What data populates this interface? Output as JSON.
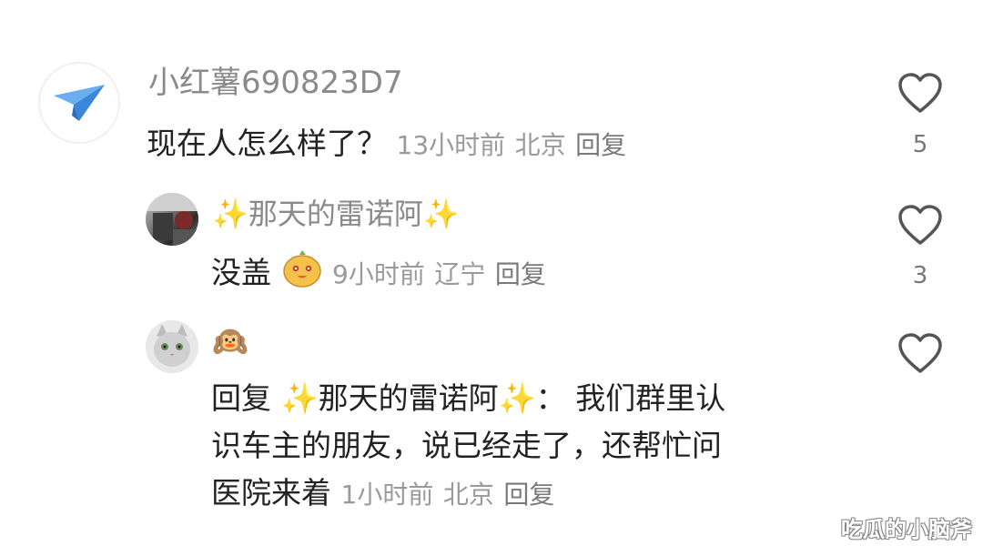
{
  "comments": [
    {
      "username": "小红薯690823D7",
      "text": "现在人怎么样了？",
      "time": "13小时前",
      "location": "北京",
      "reply_label": "回复",
      "likes": "5",
      "avatar_icon": "paper-plane-icon"
    },
    {
      "username": "✨那天的雷诺阿✨",
      "text": "没盖",
      "sticker": "potato-emoji-icon",
      "time": "9小时前",
      "location": "辽宁",
      "reply_label": "回复",
      "likes": "3",
      "avatar_icon": "photo-avatar"
    },
    {
      "username": "🙉",
      "reply_prefix": "回复",
      "reply_target": "✨那天的雷诺阿✨：",
      "text_line1": "我们群里认",
      "text_line2": "识车主的朋友，说已经走了，还帮忙问",
      "text_line3": "医院来着",
      "time": "1小时前",
      "location": "北京",
      "reply_label": "回复",
      "likes": "",
      "avatar_icon": "cat-avatar"
    }
  ],
  "watermark": "吃瓜的小脑斧",
  "colors": {
    "username": "#8a8a8a",
    "text": "#222222",
    "meta": "#9a9a9a",
    "avatar_plane": "#4a90e2"
  }
}
